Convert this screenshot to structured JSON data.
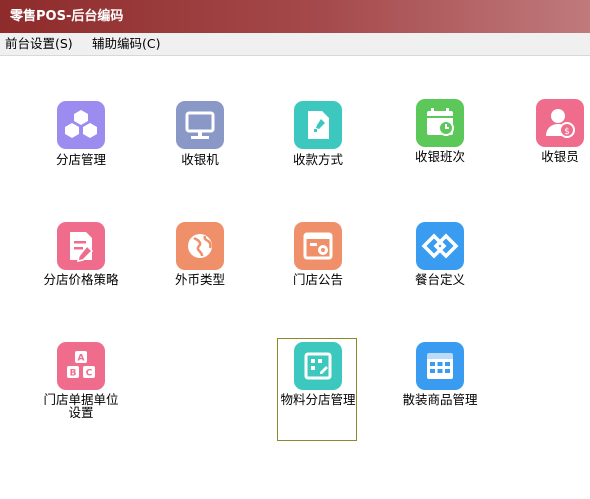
{
  "window": {
    "title": "零售POS-后台编码"
  },
  "menu": [
    {
      "label": "前台设置(S)"
    },
    {
      "label": "辅助编码(C)"
    }
  ],
  "tiles": [
    {
      "label": "分店管理",
      "icon": "cubes-icon",
      "color": "#9c8cf0"
    },
    {
      "label": "收银机",
      "icon": "monitor-icon",
      "color": "#8a98c8"
    },
    {
      "label": "收款方式",
      "icon": "document-pin-icon",
      "color": "#3cc8be"
    },
    {
      "label": "收银班次",
      "icon": "calendar-clock-icon",
      "color": "#5cc85a"
    },
    {
      "label": "收银员",
      "icon": "user-money-icon",
      "color": "#f06c8c"
    },
    {
      "label": "分店价格策略",
      "icon": "document-edit-icon",
      "color": "#f06c8c"
    },
    {
      "label": "外币类型",
      "icon": "globe-icon",
      "color": "#f0906a"
    },
    {
      "label": "门店公告",
      "icon": "notice-gear-icon",
      "color": "#f0906a"
    },
    {
      "label": "餐台定义",
      "icon": "diamond-link-icon",
      "color": "#3a9cf0"
    },
    {
      "label": "门店单据单位设置",
      "icon": "abc-blocks-icon",
      "color": "#f06c8c"
    },
    {
      "label": "物料分店管理",
      "icon": "grid-edit-icon",
      "color": "#3cc8be"
    },
    {
      "label": "散装商品管理",
      "icon": "grid-table-icon",
      "color": "#3a9cf0"
    }
  ]
}
